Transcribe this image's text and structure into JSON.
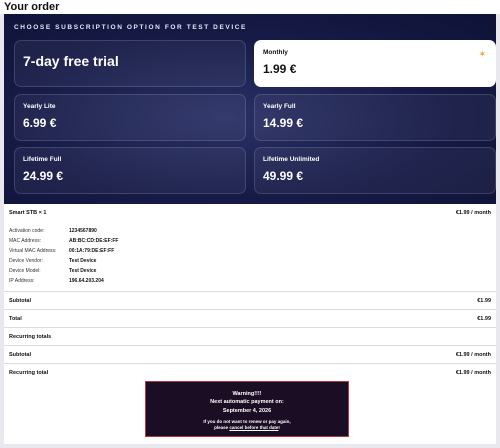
{
  "order": {
    "title": "Your order",
    "heading": "CHOOSE SUBSCRIPTION OPTION FOR TEST DEVICE",
    "plans": [
      {
        "label": "7-day free trial",
        "price": ""
      },
      {
        "label": "Monthly",
        "price": "1.99 €"
      },
      {
        "label": "Yearly Lite",
        "price": "6.99 €"
      },
      {
        "label": "Yearly Full",
        "price": "14.99 €"
      },
      {
        "label": "Lifetime Full",
        "price": "24.99 €"
      },
      {
        "label": "Lifetime Unlimited",
        "price": "49.99 €"
      }
    ],
    "selected_plan": "Monthly",
    "sparkle_icon": "sparkle-icon"
  },
  "item": {
    "name": "Smart STB  × 1",
    "price": "€1.99 / month",
    "details": [
      {
        "key": "Activation code:",
        "value": "1234567890"
      },
      {
        "key": "MAC Address:",
        "value": "AB:BC:CD:DE:EF:FF"
      },
      {
        "key": "Virtual MAC Address:",
        "value": "00:1A:79:DE:EF:FF"
      },
      {
        "key": "Device Vendor:",
        "value": "Test Device"
      },
      {
        "key": "Device Model:",
        "value": "Test Device"
      },
      {
        "key": "IP Address:",
        "value": "196.64.203.204"
      }
    ]
  },
  "totals": {
    "subtotal_label": "Subtotal",
    "subtotal_value": "€1.99",
    "total_label": "Total",
    "total_value": "€1.99",
    "recurring_heading": "Recurring totals",
    "recurring_subtotal_label": "Subtotal",
    "recurring_subtotal_value": "€1.99 / month",
    "recurring_total_label": "Recurring total",
    "recurring_total_value": "€1.99 / month"
  },
  "warning": {
    "line1": "Warning!!!!",
    "line2": "Next automatic payment on:",
    "line3": "September 4, 2026",
    "line4": "If you do not want to renew or pay again,",
    "line5_pre": "please ",
    "line5_link": "cancel before that date",
    "line5_post": "!"
  }
}
